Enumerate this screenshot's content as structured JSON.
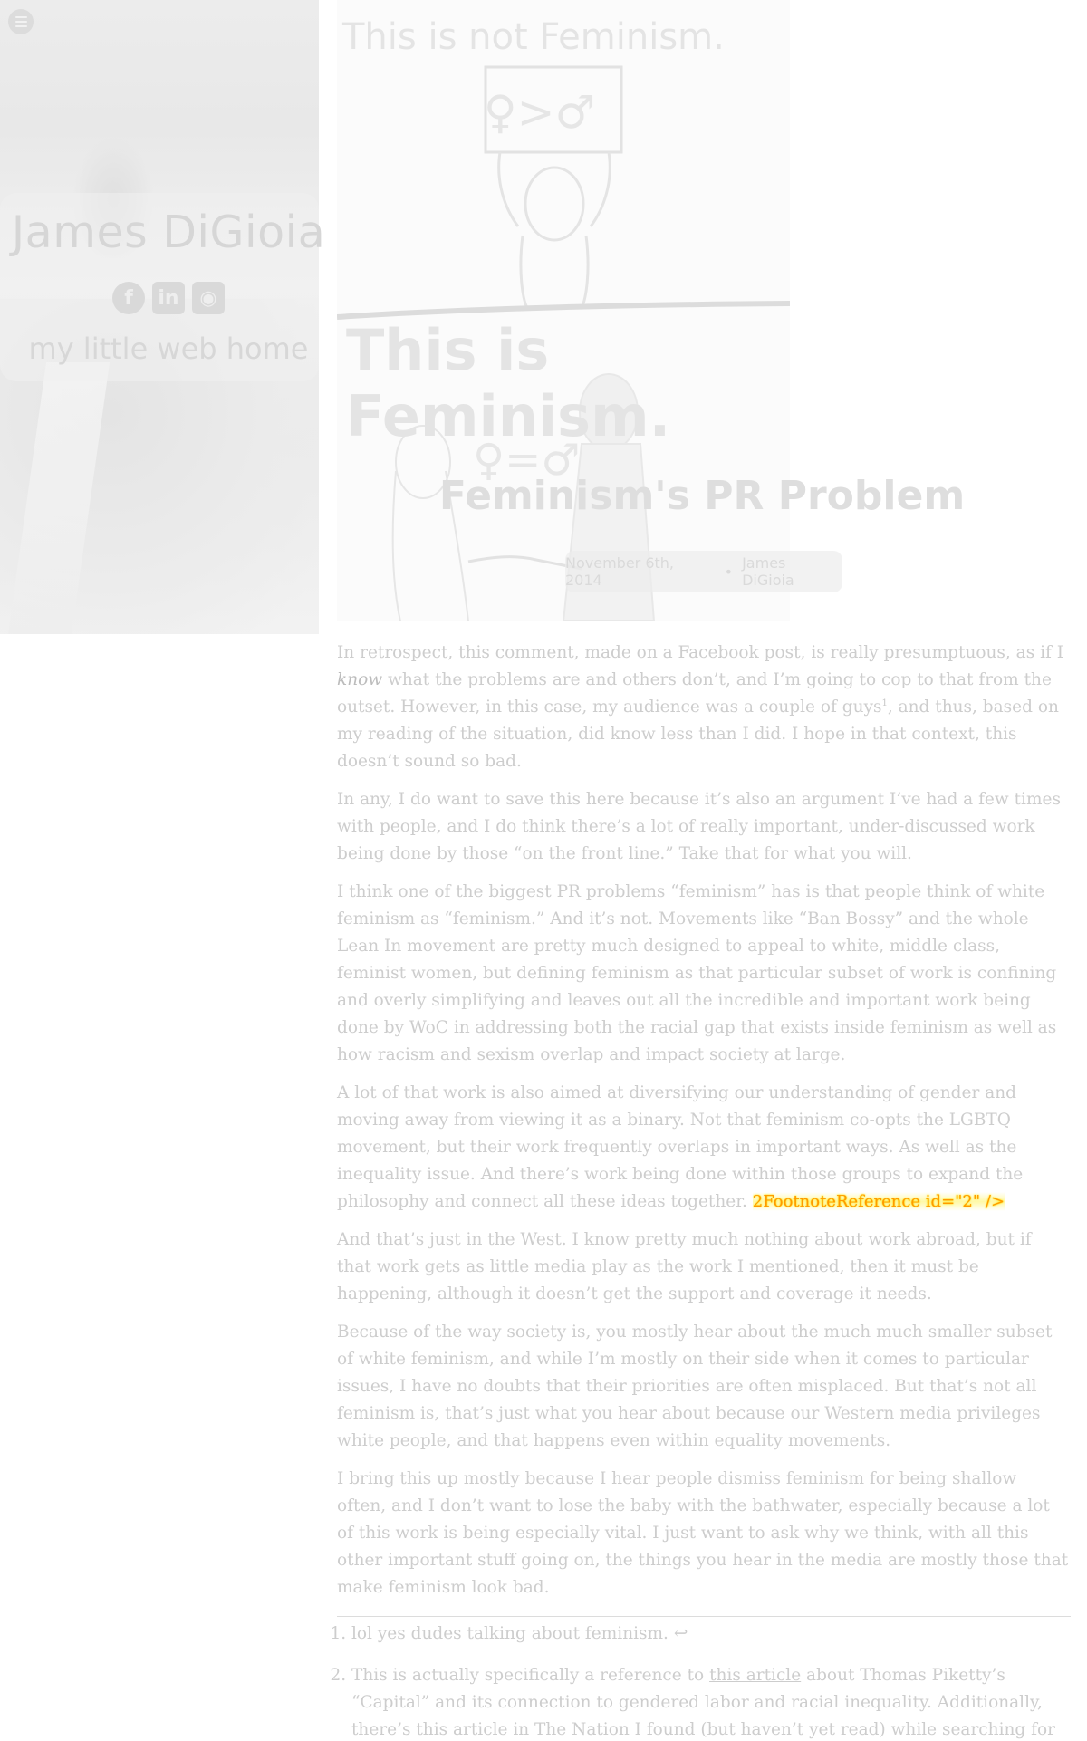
{
  "sidebar": {
    "site_title": "James DiGioia",
    "site_subtitle": "my little web home",
    "social": [
      {
        "name": "facebook-icon",
        "glyph": "f"
      },
      {
        "name": "linkedin-icon",
        "glyph": "in"
      },
      {
        "name": "github-icon",
        "glyph": "◉"
      }
    ]
  },
  "hero": {
    "line1": "This is not Feminism.",
    "sign": "♀>♂",
    "line2": "This is Feminism.",
    "eq": "♀=♂"
  },
  "post": {
    "title": "Feminism's PR Problem",
    "date": "November 6th, 2014",
    "separator": "•",
    "author": "James DiGioia"
  },
  "content": {
    "p1_a": "In retrospect, this comment, made on a Facebook post, is really presumptuous, as if I ",
    "p1_em": "know",
    "p1_b": " what the problems are and others don’t, and I’m going to cop to that from the outset. However, in this case, my audience was a couple of guys",
    "p1_fn": "1",
    "p1_c": ", and thus, based on my reading of the situation, did know less than I did. I hope in that context, this doesn’t sound so bad.",
    "p2": "In any, I do want to save this here because it’s also an argument I’ve had a few times with people, and I do think there’s a lot of really important, under-discussed work being done by those “on the front line.” Take that for what you will.",
    "p3": "I think one of the biggest PR problems “feminism” has is that people think of white feminism as “feminism.” And it’s not. Movements like “Ban Bossy” and the whole Lean In movement are pretty much designed to appeal to white, middle class, feminist women, but defining feminism as that particular subset of work is confining and overly simplifying and leaves out all the incredible and important work being done by WoC in addressing both the racial gap that exists inside feminism as well as how racism and sexism overlap and impact society at large.",
    "p4_a": "A lot of that work is also aimed at diversifying our understanding of gender and moving away from viewing it as a binary. Not that feminism co-opts the LGBTQ movement, but their work frequently overlaps in important ways. As well as the inequality issue. And there’s work being done within those groups to expand the philosophy and connect all these ideas together. ",
    "p4_tag": "2FootnoteReference id=\"2\" />",
    "p5": "And that’s just in the West. I know pretty much nothing about work abroad, but if that work gets as little media play as the work I mentioned, then it must be happening, although it doesn’t get the support and coverage it needs.",
    "p6": "Because of the way society is, you mostly hear about the much much smaller subset of white feminism, and while I’m mostly on their side when it comes to particular issues, I have no doubts that their priorities are often misplaced. But that’s not all feminism is, that’s just what you hear about because our Western media privileges white people, and that happens even within equality movements.",
    "p7": "I bring this up mostly because I hear people dismiss feminism for being shallow often, and I don’t want to lose the baby with the bathwater, especially because a lot of this work is being especially vital. I just want to ask why we think, with all this other important stuff going on, the things you hear in the media are mostly those that make feminism look bad."
  },
  "footnotes": {
    "fn1_text": "lol yes dudes talking about feminism. ",
    "backref": "↩",
    "fn2_a": "This is actually specifically a reference to ",
    "fn2_link1": "this article",
    "fn2_b": " about Thomas Piketty’s “Capital” and its connection to gendered labor and racial inequality. Additionally, there’s ",
    "fn2_link2": "this article in The Nation",
    "fn2_c": " I found (but haven’t yet read) while searching for the first. "
  }
}
